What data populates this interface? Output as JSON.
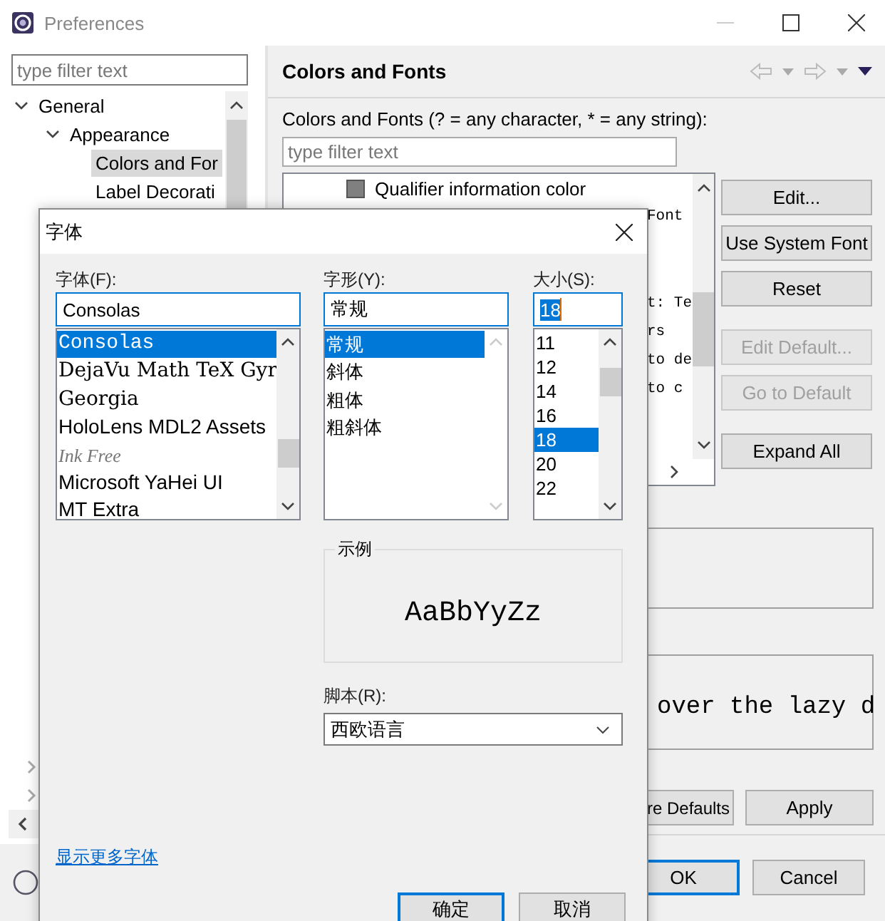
{
  "window": {
    "title": "Preferences"
  },
  "sidebar": {
    "filter_placeholder": "type filter text",
    "tree": [
      {
        "label": "General",
        "expanded": true,
        "selected": false,
        "children": [
          {
            "label": "Appearance",
            "expanded": true,
            "selected": false,
            "children": [
              {
                "label": "Colors and For",
                "selected": true
              },
              {
                "label": "Label Decorati",
                "selected": false
              }
            ]
          }
        ]
      }
    ]
  },
  "page": {
    "title": "Colors and Fonts",
    "filter_label": "Colors and Fonts (? = any character, * = any string):",
    "filter_placeholder": "type filter text",
    "tree_item": "Qualifier information color",
    "tree_fragments": [
      "Font",
      "t: Te",
      "rs",
      "to de",
      "to c"
    ],
    "buttons": [
      {
        "label": "Edit...",
        "disabled": false
      },
      {
        "label": "Use System Font",
        "disabled": false
      },
      {
        "label": "Reset",
        "disabled": false
      },
      {
        "label": "Edit Default...",
        "disabled": true
      },
      {
        "label": "Go to Default",
        "disabled": true
      },
      {
        "label": "Expand All",
        "disabled": false
      }
    ],
    "preview_text": "over the lazy d",
    "restore_button": "re Defaults",
    "apply_button": "Apply"
  },
  "dialog_buttons": [
    {
      "label": "OK",
      "default": true
    },
    {
      "label": "Cancel",
      "default": false
    }
  ],
  "font_dialog": {
    "title": "字体",
    "font": {
      "label": "字体(F):",
      "value": "Consolas",
      "items": [
        {
          "name": "Consolas",
          "kind": "mono",
          "selected": true
        },
        {
          "name": "DejaVu Math TeX Gyr",
          "kind": "serif",
          "selected": false
        },
        {
          "name": "Georgia",
          "kind": "serif",
          "selected": false
        },
        {
          "name": "HoloLens MDL2 Assets",
          "kind": "sans",
          "selected": false
        },
        {
          "name": "Ink Free",
          "kind": "script",
          "selected": false
        },
        {
          "name": "Microsoft YaHei UI",
          "kind": "sans",
          "selected": false
        },
        {
          "name": "MT Extra",
          "kind": "sans",
          "selected": false
        }
      ]
    },
    "style": {
      "label": "字形(Y):",
      "value": "常规",
      "items": [
        {
          "name": "常规",
          "selected": true
        },
        {
          "name": "斜体",
          "selected": false
        },
        {
          "name": "粗体",
          "selected": false
        },
        {
          "name": "粗斜体",
          "selected": false
        }
      ]
    },
    "size": {
      "label": "大小(S):",
      "value": "18",
      "items": [
        {
          "name": "11",
          "selected": false
        },
        {
          "name": "12",
          "selected": false
        },
        {
          "name": "14",
          "selected": false
        },
        {
          "name": "16",
          "selected": false
        },
        {
          "name": "18",
          "selected": true
        },
        {
          "name": "20",
          "selected": false
        },
        {
          "name": "22",
          "selected": false
        }
      ]
    },
    "sample": {
      "label": "示例",
      "text": "AaBbYyZz"
    },
    "script": {
      "label": "脚本(R):",
      "value": "西欧语言"
    },
    "more_fonts_link": "显示更多字体",
    "buttons": [
      {
        "label": "确定",
        "default": true
      },
      {
        "label": "取消",
        "default": false
      }
    ]
  }
}
